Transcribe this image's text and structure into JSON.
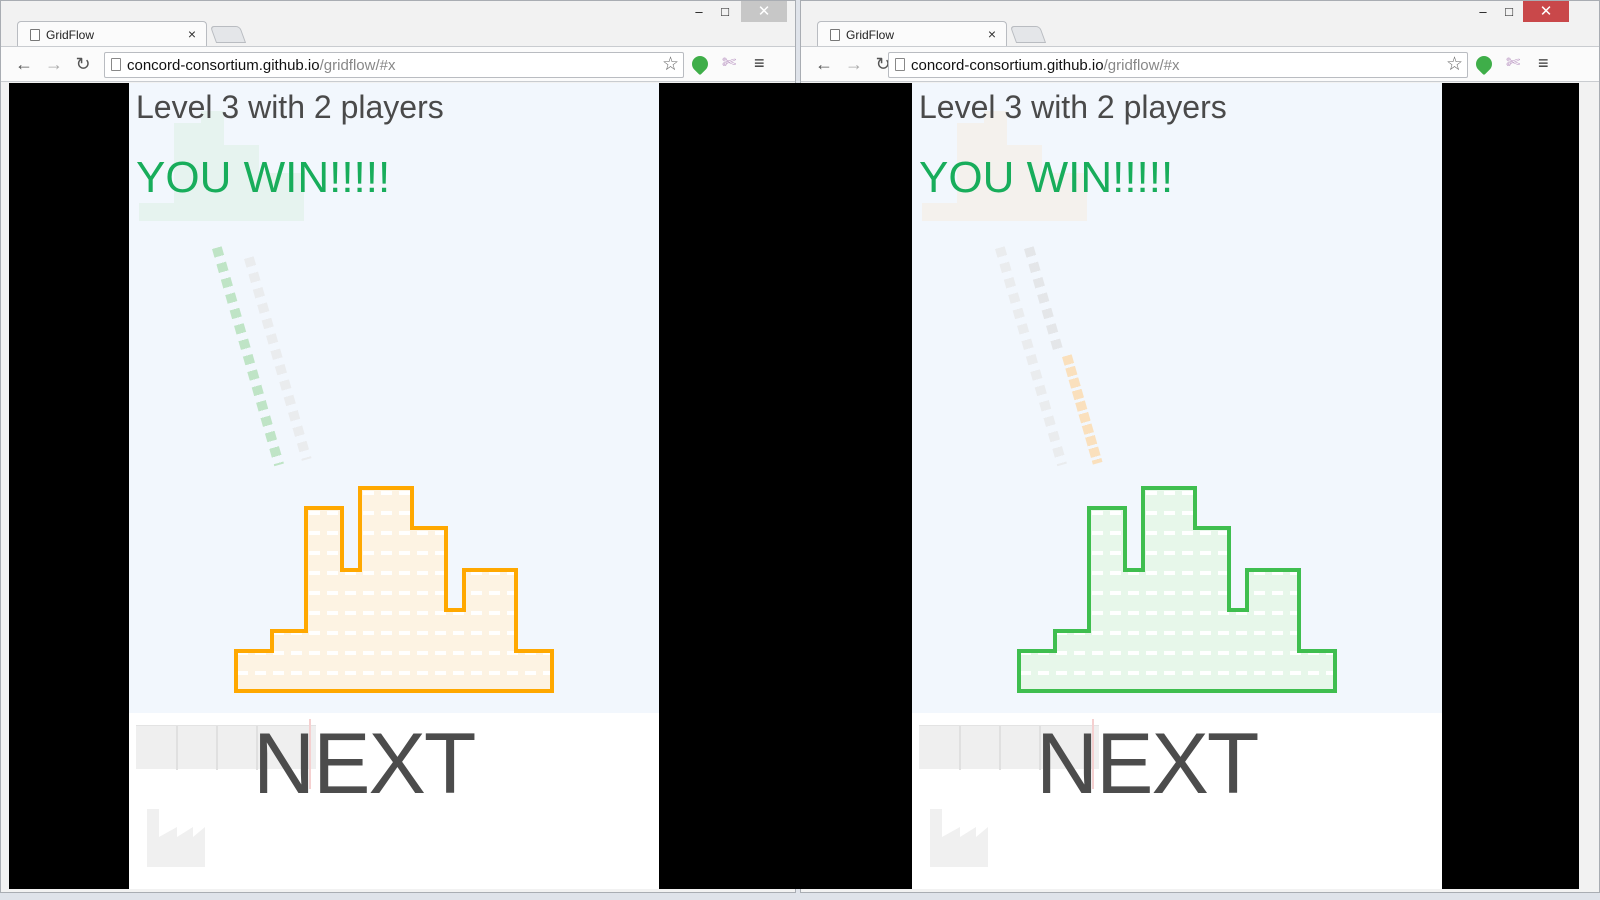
{
  "windows": [
    {
      "id": "left",
      "tab_title": "GridFlow",
      "url_host": "concord-consortium.github.io",
      "url_path": "/gridflow/#x",
      "game": {
        "level_text": "Level 3 with 2 players",
        "win_text": "YOU WIN!!!!!",
        "next_label": "NEXT",
        "player_color": "#FFA800",
        "fill_color": "#FDF3E3",
        "ghost_color": "#C6E8C9"
      }
    },
    {
      "id": "right",
      "tab_title": "GridFlow",
      "url_host": "concord-consortium.github.io",
      "url_path": "/gridflow/#x",
      "game": {
        "level_text": "Level 3 with 2 players",
        "win_text": "YOU WIN!!!!!",
        "next_label": "NEXT",
        "player_color": "#3FBE4F",
        "fill_color": "#E7F7EA",
        "ghost_color": "#FBE1BE"
      }
    }
  ],
  "window_controls": {
    "minimize": "–",
    "maximize": "□",
    "close": "✕"
  },
  "icons": {
    "back": "←",
    "forward": "→",
    "reload": "↻",
    "star": "☆",
    "menu": "≡",
    "pin": "✄",
    "tab_close": "×"
  },
  "colors": {
    "win_text": "#18AD5B",
    "play_background": "#F2F7FD",
    "chrome_close_active": "#C9484A"
  }
}
